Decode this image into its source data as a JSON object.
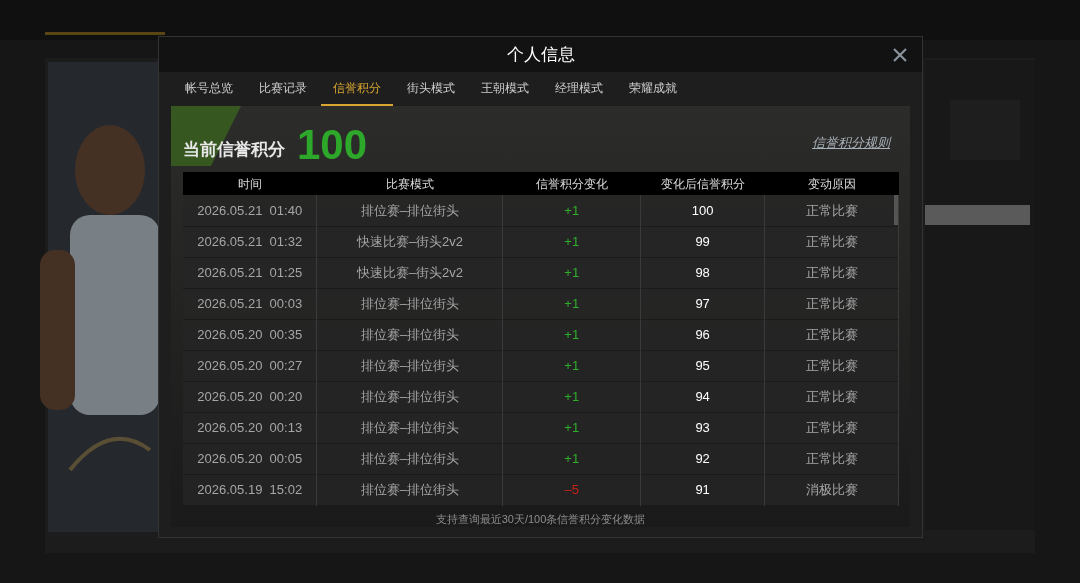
{
  "dialog": {
    "title": "个人信息"
  },
  "tabs": [
    {
      "label": "帐号总览",
      "selected": false
    },
    {
      "label": "比赛记录",
      "selected": false
    },
    {
      "label": "信誉积分",
      "selected": true
    },
    {
      "label": "街头模式",
      "selected": false
    },
    {
      "label": "王朝模式",
      "selected": false
    },
    {
      "label": "经理模式",
      "selected": false
    },
    {
      "label": "荣耀成就",
      "selected": false
    }
  ],
  "credit": {
    "label": "当前信誉积分",
    "value": "100",
    "rules_link": "信誉积分规则"
  },
  "table": {
    "columns": [
      "时间",
      "比赛模式",
      "信誉积分变化",
      "变化后信誉积分",
      "变动原因"
    ],
    "rows": [
      {
        "kind": "gain",
        "cells": [
          "2026.05.21  01:40",
          "排位赛–排位街头",
          "+1",
          "100",
          "正常比赛"
        ]
      },
      {
        "kind": "gain",
        "cells": [
          "2026.05.21  01:32",
          "快速比赛–街头2v2",
          "+1",
          "99",
          "正常比赛"
        ]
      },
      {
        "kind": "gain",
        "cells": [
          "2026.05.21  01:25",
          "快速比赛–街头2v2",
          "+1",
          "98",
          "正常比赛"
        ]
      },
      {
        "kind": "gain",
        "cells": [
          "2026.05.21  00:03",
          "排位赛–排位街头",
          "+1",
          "97",
          "正常比赛"
        ]
      },
      {
        "kind": "gain",
        "cells": [
          "2026.05.20  00:35",
          "排位赛–排位街头",
          "+1",
          "96",
          "正常比赛"
        ]
      },
      {
        "kind": "gain",
        "cells": [
          "2026.05.20  00:27",
          "排位赛–排位街头",
          "+1",
          "95",
          "正常比赛"
        ]
      },
      {
        "kind": "gain",
        "cells": [
          "2026.05.20  00:20",
          "排位赛–排位街头",
          "+1",
          "94",
          "正常比赛"
        ]
      },
      {
        "kind": "gain",
        "cells": [
          "2026.05.20  00:13",
          "排位赛–排位街头",
          "+1",
          "93",
          "正常比赛"
        ]
      },
      {
        "kind": "gain",
        "cells": [
          "2026.05.20  00:05",
          "排位赛–排位街头",
          "+1",
          "92",
          "正常比赛"
        ]
      },
      {
        "kind": "loss",
        "cells": [
          "2026.05.19  15:02",
          "排位赛–排位街头",
          "–5",
          "91",
          "消极比赛"
        ]
      }
    ]
  },
  "footer_note": "支持查询最近30天/100条信誉积分变化数据"
}
